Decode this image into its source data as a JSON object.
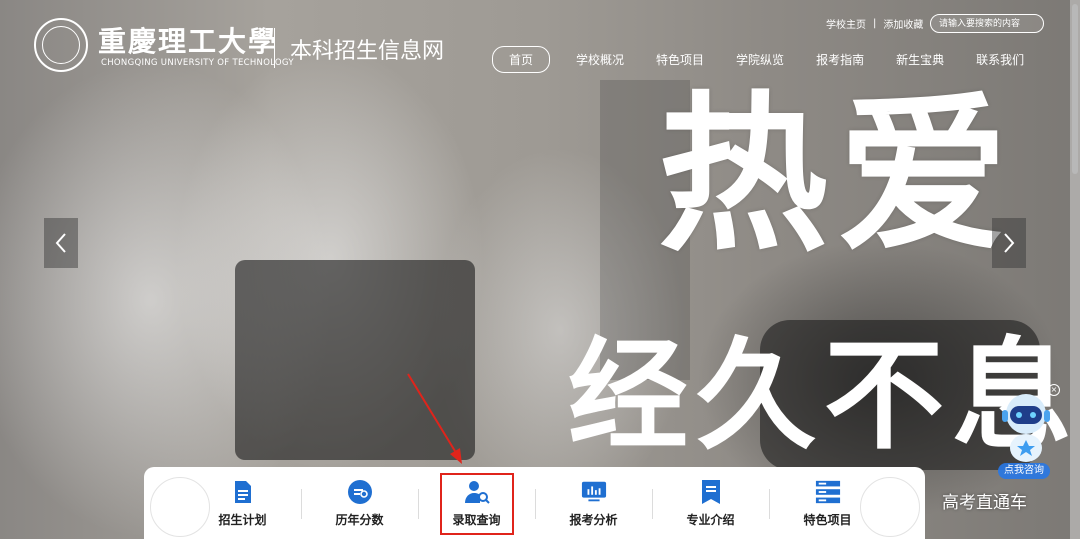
{
  "header": {
    "brand_cn": "重慶理工大學",
    "brand_en": "CHONGQING UNIVERSITY OF TECHNOLOGY",
    "site_name": "本科招生信息网",
    "top_links": [
      "学校主页",
      "添加收藏"
    ],
    "top_sep": "|",
    "search_placeholder": "请输入要搜索的内容"
  },
  "nav": {
    "items": [
      "首页",
      "学校概况",
      "特色项目",
      "学院纵览",
      "报考指南",
      "新生宝典",
      "联系我们"
    ],
    "active_index": 0
  },
  "hero": {
    "slogan_line1": "热爱",
    "slogan_line2": "经久不息"
  },
  "quick_links": [
    {
      "label": "招生计划",
      "icon": "document-list-icon"
    },
    {
      "label": "历年分数",
      "icon": "chart-bars-icon"
    },
    {
      "label": "录取查询",
      "icon": "user-search-icon"
    },
    {
      "label": "报考分析",
      "icon": "monitor-chart-icon"
    },
    {
      "label": "专业介绍",
      "icon": "bookmark-doc-icon"
    },
    {
      "label": "特色项目",
      "icon": "stack-list-icon"
    }
  ],
  "highlighted_index": 2,
  "mascot": {
    "label": "点我咨询",
    "close": "×"
  },
  "watermark": "高考直通车",
  "colors": {
    "accent_blue": "#1f6fd1",
    "highlight_red": "#e0241b"
  }
}
